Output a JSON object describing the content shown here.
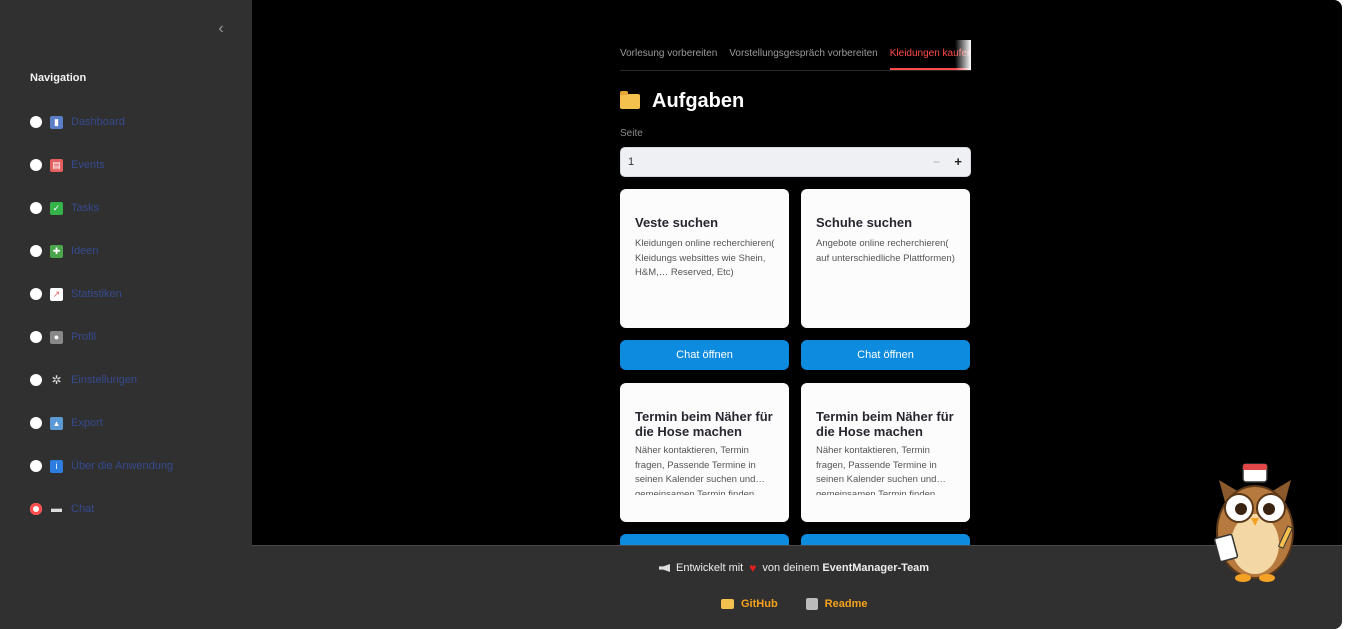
{
  "sidebar": {
    "title": "Navigation",
    "items": [
      {
        "label": "Dashboard",
        "icon": "chart-icon",
        "color": "#5b7ec8"
      },
      {
        "label": "Events",
        "icon": "calendar-icon",
        "color": "#e46060"
      },
      {
        "label": "Tasks",
        "icon": "checkmark-icon",
        "color": "#34b34a"
      },
      {
        "label": "Ideen",
        "icon": "puzzle-icon",
        "color": "#4ba64b"
      },
      {
        "label": "Statistiken",
        "icon": "trend-icon",
        "color": "#e46060"
      },
      {
        "label": "Profil",
        "icon": "person-icon",
        "color": "#888888"
      },
      {
        "label": "Einstellungen",
        "icon": "gear-icon",
        "color": "#888888"
      },
      {
        "label": "Export",
        "icon": "export-icon",
        "color": "#5b9ad5"
      },
      {
        "label": "Über die Anwendung",
        "icon": "info-icon",
        "color": "#2d7de0"
      },
      {
        "label": "Chat",
        "icon": "speech-bubble-icon",
        "color": "#888888"
      }
    ]
  },
  "tabs": [
    "Vorlesung vorbereiten",
    "Vorstellungsgespräch vorbereiten",
    "Kleidungen kaufen"
  ],
  "heading": "Aufgaben",
  "page": {
    "label": "Seite",
    "value": "1",
    "minus": "−",
    "plus": "+"
  },
  "cards": [
    {
      "title": "Veste suchen",
      "description": "Kleidungen online recherchieren( Kleidungs websittes wie Shein, H&M,… Reserved, Etc)"
    },
    {
      "title": "Schuhe suchen",
      "description": "Angebote online recherchieren( auf unterschiedliche Plattformen)"
    },
    {
      "title": "Termin beim Näher für die Hose machen",
      "description": "Näher kontaktieren, Termin fragen, Passende Termine in seinen Kalender suchen und… gemeinsamen Termin finden"
    },
    {
      "title": "Termin beim Näher für die Hose machen",
      "description": "Näher kontaktieren, Termin fragen, Passende Termine in seinen Kalender suchen und… gemeinsamen Termin finden"
    }
  ],
  "chat_button": "Chat öffnen",
  "footer": {
    "prefix": "Entwickelt mit",
    "middle": "von deinem",
    "team": "EventManager-Team",
    "links": [
      {
        "label": "GitHub",
        "icon": "folder-icon"
      },
      {
        "label": "Readme",
        "icon": "document-icon"
      }
    ]
  },
  "colors": {
    "accent": "#ff4b4b",
    "button": "#0d8bde",
    "link": "#f7a21b"
  }
}
